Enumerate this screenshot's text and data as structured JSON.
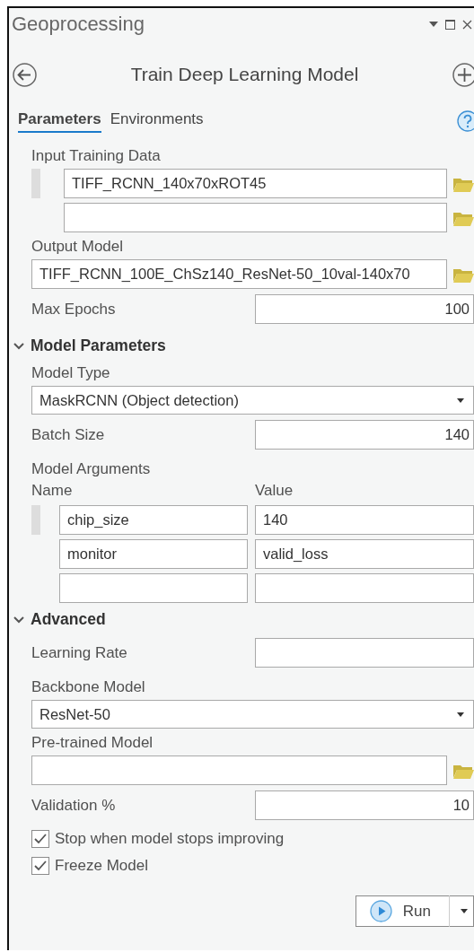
{
  "pane": {
    "title": "Geoprocessing"
  },
  "tool": {
    "title": "Train Deep Learning Model"
  },
  "tabs": [
    {
      "label": "Parameters",
      "selected": true
    },
    {
      "label": "Environments",
      "selected": false
    }
  ],
  "parameters": [
    {
      "kind": "multipath",
      "label": "Input Training Data",
      "values": [
        "TIFF_RCNN_140x70xROT45"
      ]
    },
    {
      "kind": "path",
      "label": "Output Model",
      "value": "TIFF_RCNN_100E_ChSz140_ResNet-50_10val-140x70"
    },
    {
      "kind": "number",
      "label": "Max Epochs",
      "value": "100"
    },
    {
      "kind": "group",
      "title": "Model Parameters",
      "expanded": true,
      "items": [
        {
          "kind": "dropdown",
          "label": "Model Type",
          "value": "MaskRCNN (Object detection)"
        },
        {
          "kind": "number",
          "label": "Batch Size",
          "value": "140"
        },
        {
          "kind": "table",
          "label": "Model Arguments",
          "columns": [
            "Name",
            "Value"
          ],
          "rows": [
            {
              "name": "chip_size",
              "value": "140"
            },
            {
              "name": "monitor",
              "value": "valid_loss"
            }
          ]
        }
      ]
    },
    {
      "kind": "group",
      "title": "Advanced",
      "expanded": true,
      "items": [
        {
          "kind": "number",
          "label": "Learning Rate"
        },
        {
          "kind": "dropdown",
          "label": "Backbone Model",
          "value": "ResNet-50"
        },
        {
          "kind": "path",
          "label": "Pre-trained Model"
        },
        {
          "kind": "number",
          "label": "Validation %",
          "value": "10"
        },
        {
          "kind": "checkbox",
          "label": "Stop when model stops improving",
          "checked": true
        },
        {
          "kind": "checkbox",
          "label": "Freeze Model",
          "checked": true
        }
      ]
    }
  ],
  "run_button": {
    "label": "Run"
  }
}
